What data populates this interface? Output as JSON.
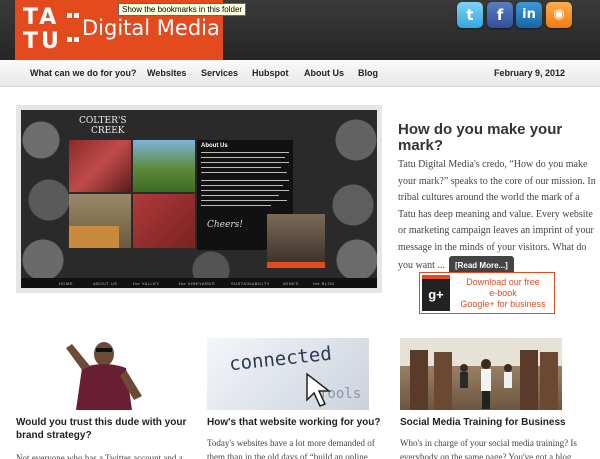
{
  "header": {
    "logo_letters_top": "TA",
    "logo_letters_bottom": "TU",
    "brand_name": "Digital Media",
    "tooltip": "Show the bookmarks in this folder",
    "brand_color": "#e34a1e",
    "social": [
      {
        "name": "twitter",
        "glyph": "t"
      },
      {
        "name": "facebook",
        "glyph": "f"
      },
      {
        "name": "linkedin",
        "glyph": "in"
      },
      {
        "name": "rss",
        "glyph": "◉"
      }
    ]
  },
  "nav": {
    "items": [
      "What can we do for you?",
      "Websites",
      "Services",
      "Hubspot",
      "About Us",
      "Blog"
    ],
    "date": "February 9, 2012"
  },
  "feature": {
    "logo_line1": "COLTER'S",
    "logo_line2": "CREEK",
    "about_title": "About Us",
    "signature": "Cheers!",
    "site_nav": [
      "HOME",
      "ABOUT US",
      "the VALLEY",
      "the VINEYARDS",
      "SUSTAINABILITY",
      "WINES",
      "the BLOG"
    ]
  },
  "intro": {
    "title": "How do you make your mark?",
    "body": "Tatu Digital Media's credo, “How do you make your mark?” speaks to the core of our mission. In tribal cultures around the world the mark of a Tatu has deep meaning and value. Every website or marketing campaign leaves an imprint of your message in the minds of your visitors. What do you want ...",
    "read_more": "[Read More...]"
  },
  "gplus": {
    "icon_text": "g+",
    "line1": "Download our free",
    "line2": "e-book",
    "line3": "Google+ for business"
  },
  "cards": [
    {
      "title": "Would you trust this dude with your brand strategy?",
      "body": "Not everyone who has a Twitter account and a"
    },
    {
      "title": "How's that website working for you?",
      "image_word": "connected",
      "image_word2": "Tools",
      "body": "Today's websites have a lot more demanded of them than  in the old days of “build an online"
    },
    {
      "title": "Social Media Training for Business",
      "body": "Who's in charge of your social media training? Is everybody on the same page? You've got a blog,"
    }
  ]
}
